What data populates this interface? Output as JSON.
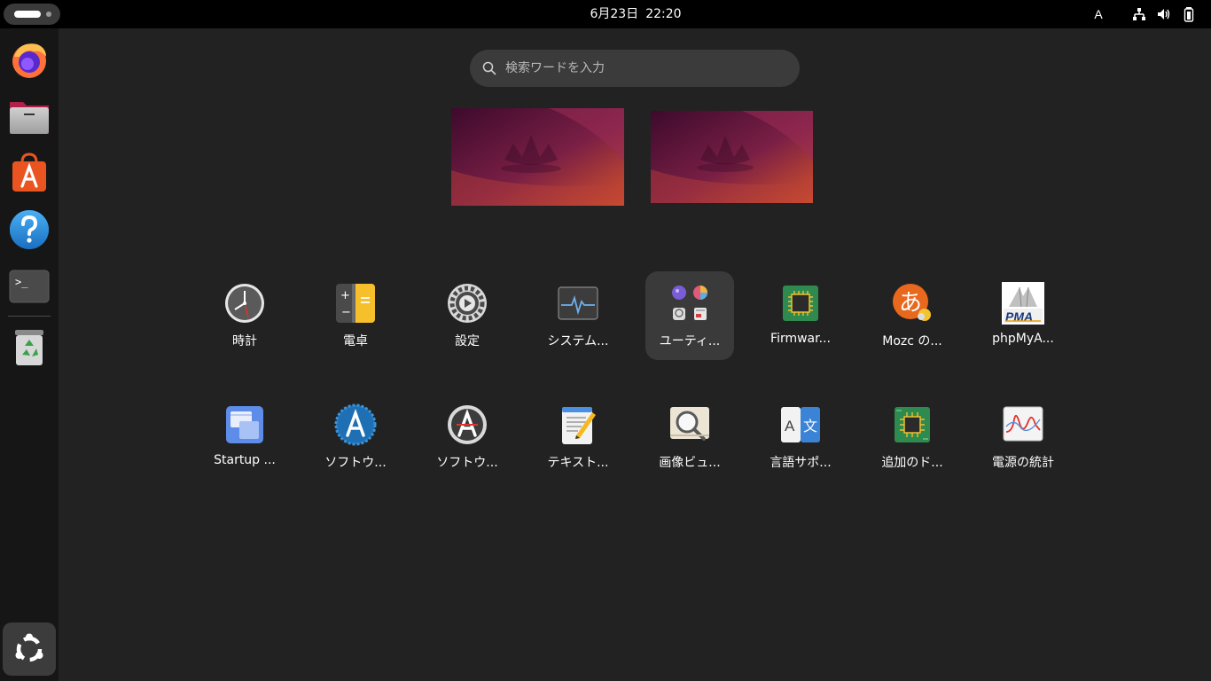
{
  "topbar": {
    "date": "6月23日",
    "time": "22:20",
    "input_method": "A",
    "tray_icons": [
      "network-wired-icon",
      "volume-icon",
      "battery-icon"
    ]
  },
  "dock": {
    "items": [
      {
        "name": "firefox",
        "icon": "firefox-icon"
      },
      {
        "name": "files",
        "icon": "files-icon"
      },
      {
        "name": "app-center",
        "icon": "app-center-icon"
      },
      {
        "name": "help",
        "icon": "help-icon"
      },
      {
        "name": "terminal",
        "icon": "terminal-icon",
        "glyph": ">_"
      },
      {
        "name": "trash",
        "icon": "trash-icon"
      }
    ],
    "show_apps_icon": "ubuntu-logo-icon"
  },
  "search": {
    "placeholder": "検索ワードを入力",
    "value": ""
  },
  "workspaces": [
    "workspace-1",
    "workspace-2"
  ],
  "apps": [
    {
      "label": "時計",
      "icon": "clock-icon",
      "selected": false
    },
    {
      "label": "電卓",
      "icon": "calculator-icon",
      "selected": false
    },
    {
      "label": "設定",
      "icon": "settings-icon",
      "selected": false
    },
    {
      "label": "システム...",
      "icon": "system-monitor-icon",
      "selected": false
    },
    {
      "label": "ユーティ...",
      "icon": "utilities-folder-icon",
      "selected": true
    },
    {
      "label": "Firmwar...",
      "icon": "firmware-icon",
      "selected": false
    },
    {
      "label": "Mozc の...",
      "icon": "mozc-icon",
      "selected": false
    },
    {
      "label": "phpMyA...",
      "icon": "phpmyadmin-icon",
      "selected": false
    },
    {
      "label": "Startup ...",
      "icon": "startup-disk-icon",
      "selected": false
    },
    {
      "label": "ソフトウ...",
      "icon": "software-updater-icon",
      "selected": false
    },
    {
      "label": "ソフトウ...",
      "icon": "software-properties-icon",
      "selected": false
    },
    {
      "label": "テキスト...",
      "icon": "text-editor-icon",
      "selected": false
    },
    {
      "label": "画像ビュ...",
      "icon": "image-viewer-icon",
      "selected": false
    },
    {
      "label": "言語サポ...",
      "icon": "language-support-icon",
      "selected": false
    },
    {
      "label": "追加のド...",
      "icon": "additional-drivers-icon",
      "selected": false
    },
    {
      "label": "電源の統計",
      "icon": "power-statistics-icon",
      "selected": false
    }
  ],
  "colors": {
    "background": "#222222",
    "topbar": "#000000",
    "dock": "#161616",
    "search_field": "#3b3b3b",
    "selection": "#3a3a3a",
    "accent_orange": "#e95420"
  }
}
